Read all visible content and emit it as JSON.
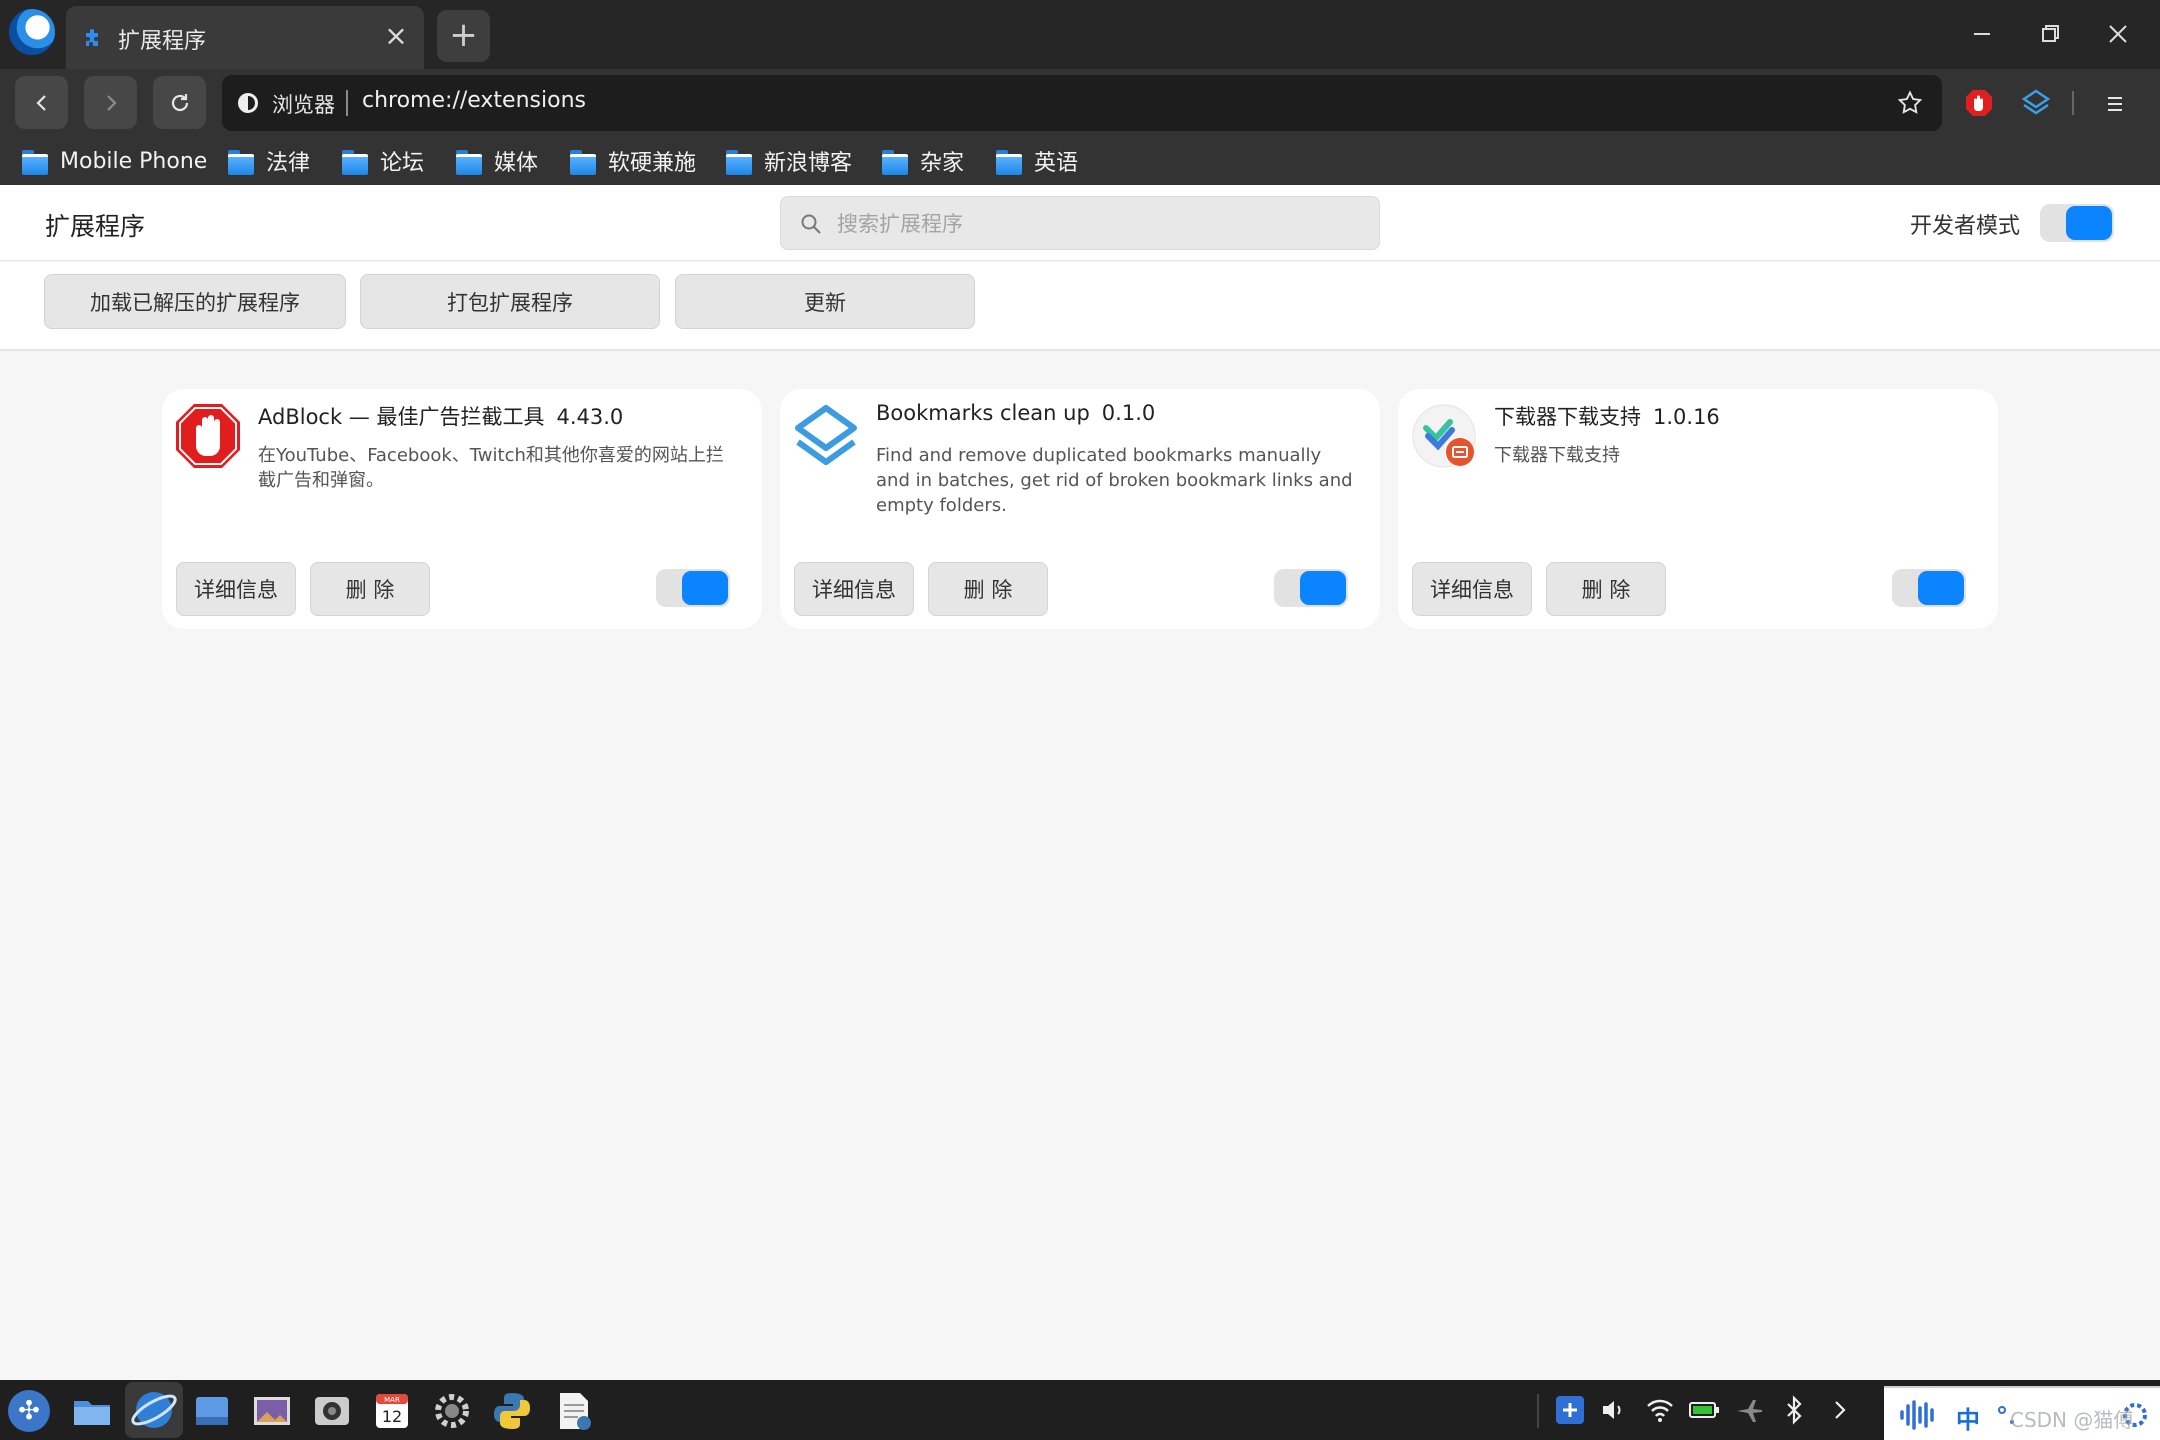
{
  "tab": {
    "title": "扩展程序",
    "close": "×"
  },
  "newtab": {
    "label": "+"
  },
  "omnibox": {
    "site_label": "浏览器",
    "url": "chrome://extensions"
  },
  "bookmarks": [
    "Mobile Phone",
    "法律",
    "论坛",
    "媒体",
    "软硬兼施",
    "新浪博客",
    "杂家",
    "英语"
  ],
  "header": {
    "title": "扩展程序",
    "search_placeholder": "搜索扩展程序",
    "dev_mode_label": "开发者模式",
    "dev_mode_on": true
  },
  "actions": {
    "load_unpacked": "加载已解压的扩展程序",
    "pack": "打包扩展程序",
    "update": "更新"
  },
  "extensions": [
    {
      "name": "AdBlock — 最佳广告拦截工具",
      "version": "4.43.0",
      "description": "在YouTube、Facebook、Twitch和其他你喜爱的网站上拦截广告和弹窗。",
      "details_label": "详细信息",
      "remove_label": "删 除",
      "enabled": true,
      "icon": "adblock-hand-icon"
    },
    {
      "name": "Bookmarks clean up",
      "version": "0.1.0",
      "description": "Find and remove duplicated bookmarks manually and in batches, get rid of broken bookmark links and empty folders.",
      "details_label": "详细信息",
      "remove_label": "删 除",
      "enabled": true,
      "icon": "layers-icon"
    },
    {
      "name": "下载器下载支持",
      "version": "1.0.16",
      "description": "下载器下载支持",
      "details_label": "详细信息",
      "remove_label": "删 除",
      "enabled": true,
      "icon": "downloader-icon"
    }
  ],
  "taskbar": {
    "ime_label": "中",
    "calendar_day": "12",
    "calendar_month": "MAR"
  },
  "watermark": "CSDN @猫傅",
  "colors": {
    "accent": "#0a84ff",
    "titlebar": "#262626",
    "toolbar": "#333333",
    "page_bg": "#f6f6f6"
  }
}
